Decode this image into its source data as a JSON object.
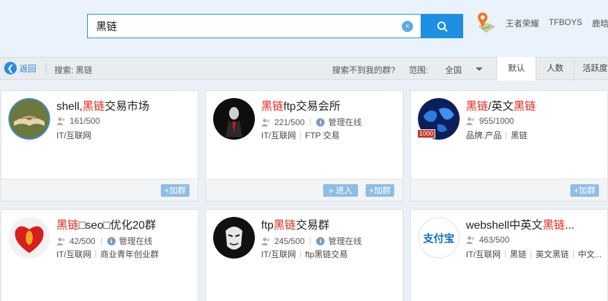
{
  "search": {
    "query": "黑链",
    "clear_glyph": "×"
  },
  "hot_links": [
    "王者荣耀",
    "TFBOYS",
    "鹿晗"
  ],
  "filter": {
    "back_label": "返回",
    "search_label": "搜索: 黑链",
    "not_found": "搜索不到我的群?",
    "scope_label": "范围:",
    "scope_value": "全国",
    "sort_tabs": [
      "默认",
      "人数",
      "活跃度"
    ]
  },
  "cards": [
    {
      "title_parts": [
        "shell,",
        "黑链",
        "交易市场"
      ],
      "members": "161/500",
      "managed": "",
      "tags": [
        "IT/互联网"
      ],
      "buttons": [
        "+加群"
      ]
    },
    {
      "title_parts": [
        "",
        "黑链",
        "ftp交易会所"
      ],
      "members": "221/500",
      "managed": "管理在线",
      "tags": [
        "IT/互联网",
        "FTP 交易"
      ],
      "buttons": [
        "» 进入",
        "+加群"
      ]
    },
    {
      "title_parts": [
        "",
        "黑链",
        "/英文",
        "黑链"
      ],
      "members": "955/1000",
      "managed": "",
      "tags": [
        "品牌.产品",
        "黑链"
      ],
      "buttons": [
        "+加群"
      ],
      "badge": "1000"
    },
    {
      "title_parts": [
        "",
        "黑链",
        "□seo□优化20群"
      ],
      "members": "42/500",
      "managed": "管理在线",
      "tags": [
        "IT/互联网",
        "商业青年创业群"
      ],
      "buttons": []
    },
    {
      "title_parts": [
        "ftp",
        "黑链",
        "交易群"
      ],
      "members": "245/500",
      "managed": "管理在线",
      "tags": [
        "IT/互联网",
        "ftp黑链交易"
      ],
      "buttons": []
    },
    {
      "title_parts": [
        "webshell中英文",
        "黑链",
        "..."
      ],
      "members": "463/500",
      "managed": "",
      "tags": [
        "IT/互联网",
        "黑链",
        "英文黑链",
        "中文..."
      ],
      "buttons": []
    }
  ],
  "alipay_logo_text": "支付宝",
  "colors": {
    "accent": "#1e8fe1",
    "highlight": "#e0231a",
    "button": "#8ebde6"
  }
}
